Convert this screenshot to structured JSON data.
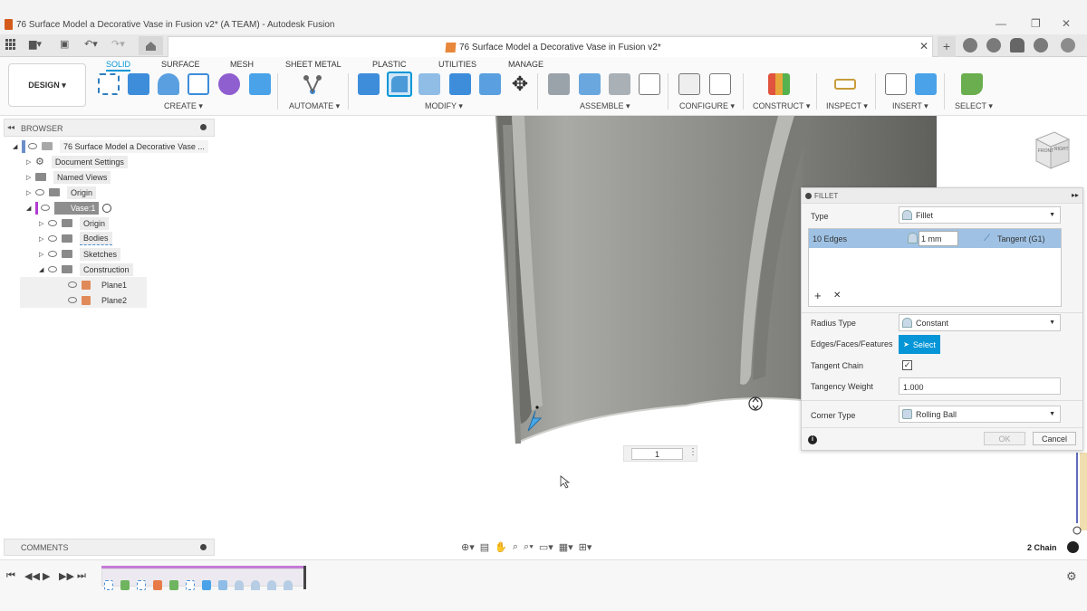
{
  "window": {
    "title": "76 Surface Model a Decorative Vase in Fusion v2* (A TEAM) - Autodesk Fusion",
    "controls": [
      "—",
      "❐",
      "✕"
    ]
  },
  "doc_tab": {
    "title": "76 Surface Model a Decorative Vase in Fusion v2*",
    "close": "✕"
  },
  "workspace": {
    "label": "DESIGN ▾"
  },
  "toolbar": {
    "tabs": [
      "SOLID",
      "SURFACE",
      "MESH",
      "SHEET METAL",
      "PLASTIC",
      "UTILITIES",
      "MANAGE"
    ],
    "groups": [
      "CREATE ▾",
      "AUTOMATE ▾",
      "MODIFY ▾",
      "ASSEMBLE ▾",
      "CONFIGURE ▾",
      "CONSTRUCT ▾",
      "INSPECT ▾",
      "INSERT ▾",
      "SELECT ▾"
    ]
  },
  "browser": {
    "title": "BROWSER",
    "items": [
      {
        "label": "76 Surface Model a Decorative Vase ..."
      },
      {
        "label": "Document Settings"
      },
      {
        "label": "Named Views"
      },
      {
        "label": "Origin"
      },
      {
        "label": "Vase:1"
      },
      {
        "label": "Origin"
      },
      {
        "label": "Bodies"
      },
      {
        "label": "Sketches"
      },
      {
        "label": "Construction"
      },
      {
        "label": "Plane1"
      },
      {
        "label": "Plane2"
      }
    ]
  },
  "fillet": {
    "title": "FILLET",
    "type_label": "Type",
    "type_value": "Fillet",
    "edges_count": "10 Edges",
    "radius": "1 mm",
    "continuity": "Tangent (G1)",
    "add": "+",
    "remove": "✕",
    "radius_type_label": "Radius Type",
    "radius_type_value": "Constant",
    "efs_label": "Edges/Faces/Features",
    "select_label": "Select",
    "tangent_chain_label": "Tangent Chain",
    "tangency_weight_label": "Tangency Weight",
    "tangency_weight_value": "1.000",
    "corner_type_label": "Corner Type",
    "corner_type_value": "Rolling Ball",
    "ok": "OK",
    "cancel": "Cancel"
  },
  "viewport": {
    "value_input": "1",
    "status": "2 Chain"
  },
  "viewcube": {
    "front": "FRONT",
    "right": "RIGHT"
  },
  "comments": {
    "title": "COMMENTS"
  }
}
